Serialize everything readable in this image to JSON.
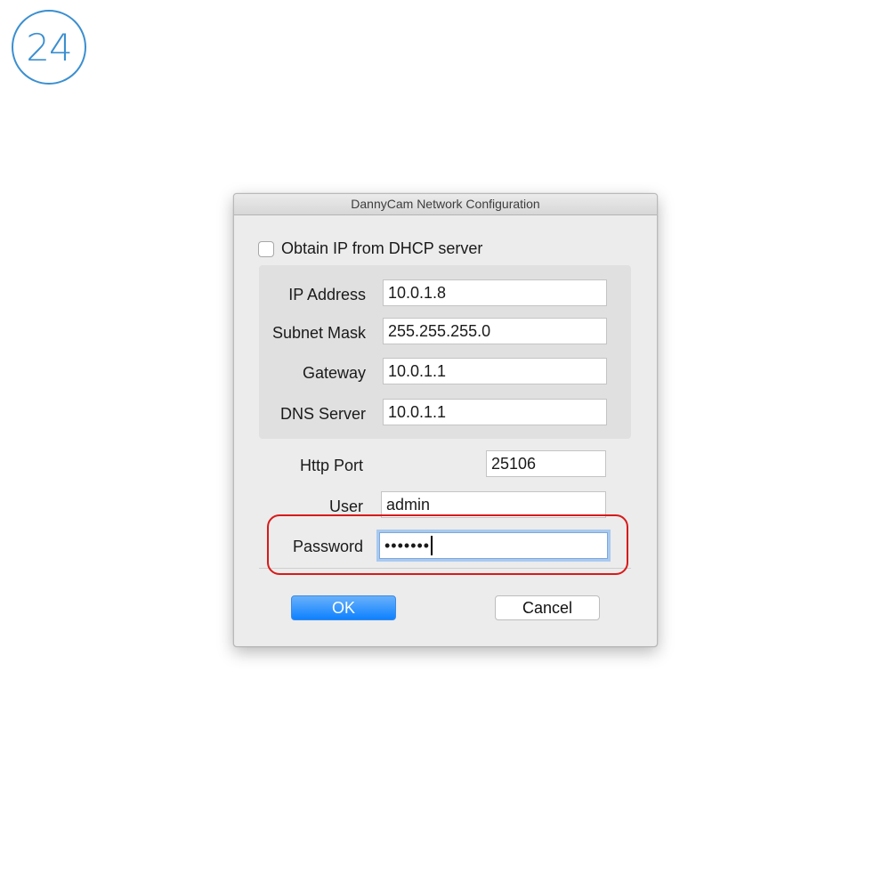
{
  "step_number": "24",
  "dialog": {
    "title": "DannyCam Network Configuration",
    "dhcp_label": "Obtain IP from DHCP server",
    "dhcp_checked": false,
    "ip_address_label": "IP Address",
    "ip_address_value": "10.0.1.8",
    "subnet_mask_label": "Subnet Mask",
    "subnet_mask_value": "255.255.255.0",
    "gateway_label": "Gateway",
    "gateway_value": "10.0.1.1",
    "dns_label": "DNS Server",
    "dns_value": "10.0.1.1",
    "http_port_label": "Http Port",
    "http_port_value": "25106",
    "user_label": "User",
    "user_value": "admin",
    "password_label": "Password",
    "password_masked": "•••••••",
    "ok_label": "OK",
    "cancel_label": "Cancel"
  },
  "colors": {
    "badge": "#3b8fd0",
    "highlight": "#d81a1a",
    "ok_button": "#1a86fe"
  }
}
